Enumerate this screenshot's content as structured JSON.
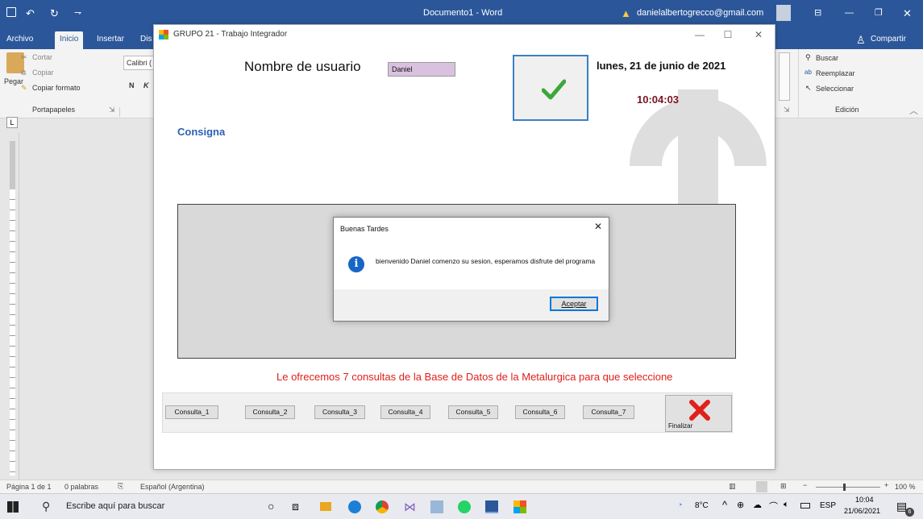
{
  "word": {
    "doc_title": "Documento1 - Word",
    "account": "danielalbertogrecco@gmail.com",
    "tabs": [
      "Archivo",
      "Inicio",
      "Insertar",
      "Dis"
    ],
    "share": "Compartir",
    "ribbon": {
      "cut": "Cortar",
      "copy": "Copiar",
      "paste": "Pegar",
      "format_painter": "Copiar formato",
      "font": "Calibri (",
      "clipboard_group": "Portapapeles",
      "find": "Buscar",
      "replace": "Reemplazar",
      "select": "Seleccionar",
      "editing_group": "Edición"
    },
    "status": {
      "page": "Página 1 de 1",
      "words": "0 palabras",
      "language": "Español (Argentina)",
      "zoom": "100 %"
    }
  },
  "form": {
    "title": "GRUPO 21 - Trabajo Integrador",
    "user_label": "Nombre de usuario",
    "user_value": "Daniel",
    "date": "lunes, 21 de junio de 2021",
    "time": "10:04:03",
    "consigna": "Consigna",
    "offer": "Le ofrecemos 7 consultas de la Base de Datos de la Metalurgica para que seleccione",
    "buttons": [
      "Consulta_1",
      "Consulta_2",
      "Consulta_3",
      "Consulta_4",
      "Consulta_5",
      "Consulta_6",
      "Consulta_7"
    ],
    "finish": "Finalizar"
  },
  "dialog": {
    "title": "Buenas Tardes",
    "message": "bienvenido Daniel comenzo su sesion, esperamos disfrute del programa",
    "ok": "Aceptar"
  },
  "taskbar": {
    "search_placeholder": "Escribe aquí para buscar",
    "temperature": "8°C",
    "lang": "ESP",
    "clock_time": "10:04",
    "clock_date": "21/06/2021",
    "notifications": "6"
  },
  "colors": {
    "word_blue": "#2b579a",
    "offer_red": "#e0201b",
    "time_red": "#7a1420",
    "consigna_blue": "#2b62b5",
    "input_bg": "#d9c2df"
  }
}
